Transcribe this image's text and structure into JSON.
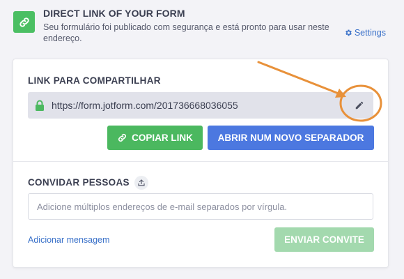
{
  "header": {
    "title": "DIRECT LINK OF YOUR FORM",
    "description": "Seu formulário foi publicado com segurança e está pronto para usar neste endereço.",
    "settings_label": "Settings"
  },
  "share": {
    "title": "LINK PARA COMPARTILHAR",
    "url": "https://form.jotform.com/201736668036055",
    "copy_label": "COPIAR LINK",
    "open_label": "ABRIR NUM NOVO SEPARADOR"
  },
  "invite": {
    "title": "CONVIDAR PESSOAS",
    "email_placeholder": "Adicione múltiplos endereços de e-mail separados por vírgula.",
    "add_message_label": "Adicionar mensagem",
    "send_label": "ENVIAR CONVITE"
  },
  "colors": {
    "accent_green": "#4bb85f",
    "accent_blue": "#4c78e0",
    "link_blue": "#3a71c9",
    "annotation_orange": "#e8913a"
  },
  "icons": {
    "header": "link-icon",
    "settings": "gear-icon",
    "url": "lock-icon",
    "edit": "pencil-icon",
    "copy": "link-icon",
    "invite": "upload-icon"
  }
}
